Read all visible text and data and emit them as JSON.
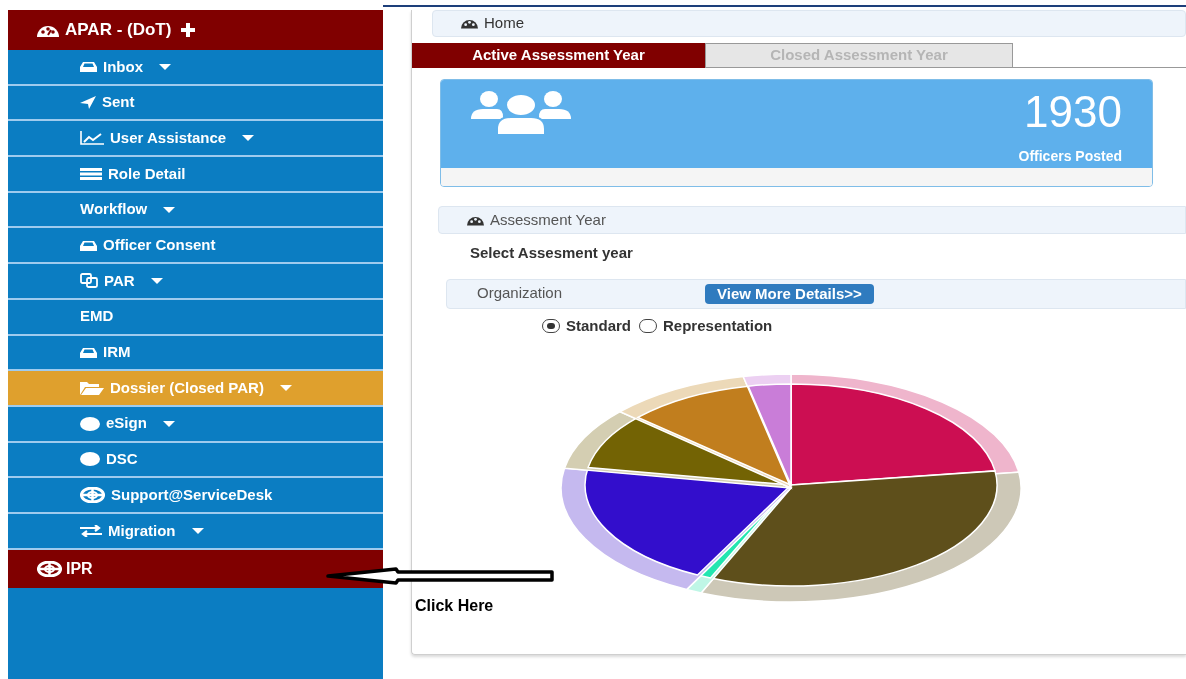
{
  "sidebar": {
    "header": {
      "label": "APAR - (DoT)"
    },
    "items": [
      {
        "label": "Inbox",
        "kind": "tray",
        "dropdown": true,
        "selected": false
      },
      {
        "label": "Sent",
        "kind": "send",
        "dropdown": false,
        "selected": false
      },
      {
        "label": "User Assistance",
        "kind": "chart",
        "dropdown": true,
        "selected": false
      },
      {
        "label": "Role Detail",
        "kind": "list",
        "dropdown": false,
        "selected": false
      },
      {
        "label": "Workflow",
        "kind": "none",
        "dropdown": true,
        "selected": false
      },
      {
        "label": "Officer Consent",
        "kind": "tray",
        "dropdown": false,
        "selected": false
      },
      {
        "label": "PAR",
        "kind": "copy",
        "dropdown": true,
        "selected": false
      },
      {
        "label": "EMD",
        "kind": "none",
        "dropdown": false,
        "selected": false
      },
      {
        "label": "IRM",
        "kind": "tray",
        "dropdown": false,
        "selected": false
      },
      {
        "label": "Dossier (Closed PAR)",
        "kind": "folder",
        "dropdown": true,
        "selected": true
      },
      {
        "label": "eSign",
        "kind": "dot",
        "dropdown": true,
        "selected": false
      },
      {
        "label": "DSC",
        "kind": "dot",
        "dropdown": false,
        "selected": false
      },
      {
        "label": "Support@ServiceDesk",
        "kind": "lifebuoy",
        "dropdown": false,
        "selected": false
      },
      {
        "label": "Migration",
        "kind": "exchange",
        "dropdown": true,
        "selected": false
      }
    ],
    "footer_item": {
      "label": "IPR"
    }
  },
  "breadcrumb": "Home",
  "tabs": [
    {
      "label": "Active Assessment Year",
      "selected": true
    },
    {
      "label": "Closed Assessment Year",
      "selected": false
    }
  ],
  "stat_card": {
    "value": "1930",
    "label": "Officers Posted"
  },
  "assessment_panel": {
    "title": "Assessment Year",
    "prompt": "Select Assesment year",
    "organization_label": "Organization",
    "details_button": "View More Details>>",
    "view_options": [
      {
        "label": "Standard",
        "selected": true
      },
      {
        "label": "Representation",
        "selected": false
      }
    ]
  },
  "annotation": {
    "text": "Click Here"
  }
}
